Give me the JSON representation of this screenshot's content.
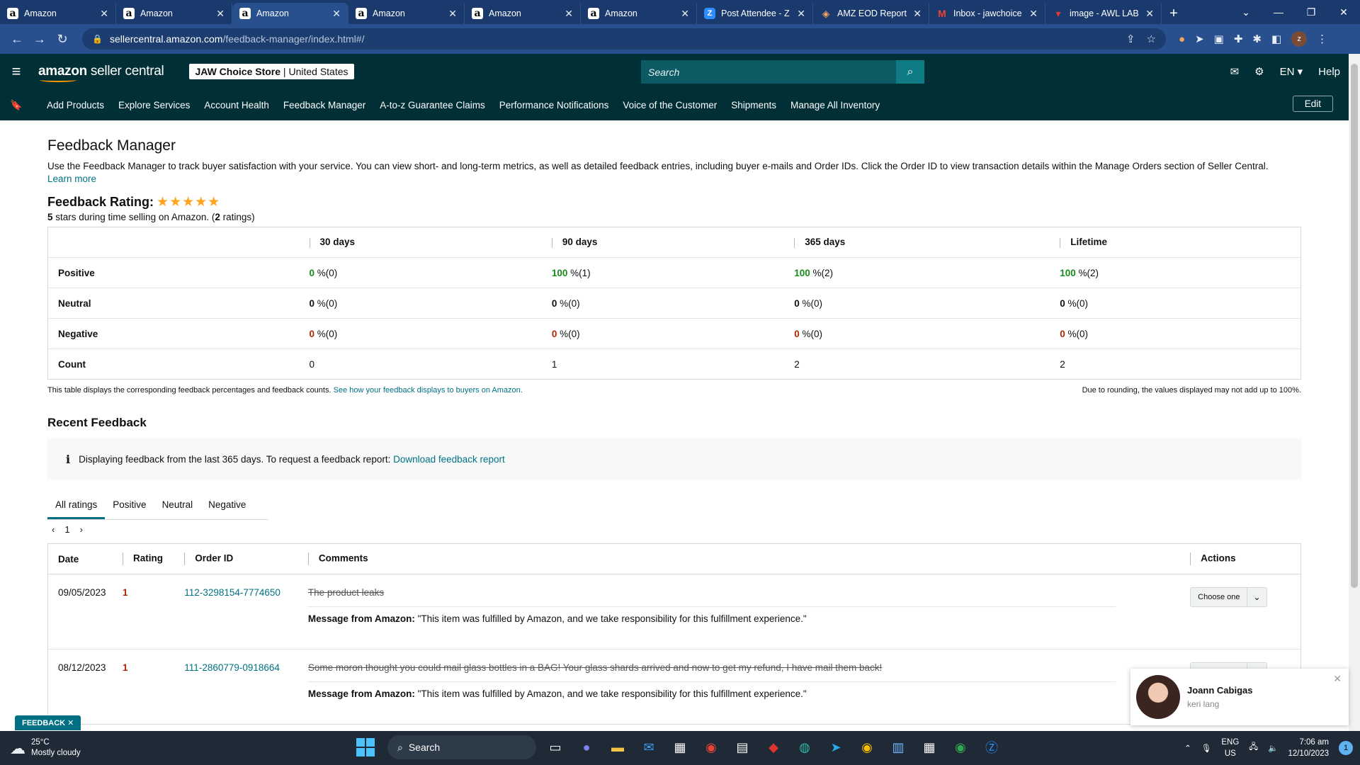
{
  "browser": {
    "tabs": [
      {
        "title": "Amazon",
        "icon": "amazon",
        "active": false
      },
      {
        "title": "Amazon",
        "icon": "amazon",
        "active": false
      },
      {
        "title": "Amazon",
        "icon": "amazon",
        "active": true
      },
      {
        "title": "Amazon",
        "icon": "amazon",
        "active": false
      },
      {
        "title": "Amazon",
        "icon": "amazon",
        "active": false
      },
      {
        "title": "Amazon",
        "icon": "amazon",
        "active": false
      },
      {
        "title": "Post Attendee - Z",
        "icon": "zoom",
        "active": false
      },
      {
        "title": "AMZ EOD Report",
        "icon": "eod",
        "active": false
      },
      {
        "title": "Inbox - jawchoice",
        "icon": "gmail",
        "active": false
      },
      {
        "title": "image - AWL LAB",
        "icon": "image",
        "active": false
      }
    ],
    "url_host": "sellercentral.amazon.com",
    "url_path": "/feedback-manager/index.html#/"
  },
  "header": {
    "logo_main": "amazon",
    "logo_sub": " seller central",
    "store_name": "JAW Choice Store",
    "store_region": "United States",
    "search_placeholder": "Search",
    "lang": "EN",
    "help": "Help"
  },
  "nav": {
    "items": [
      "Add Products",
      "Explore Services",
      "Account Health",
      "Feedback Manager",
      "A-to-z Guarantee Claims",
      "Performance Notifications",
      "Voice of the Customer",
      "Shipments",
      "Manage All Inventory"
    ],
    "edit": "Edit"
  },
  "page": {
    "title": "Feedback Manager",
    "intro": "Use the Feedback Manager to track buyer satisfaction with your service. You can view short- and long-term metrics, as well as detailed feedback entries, including buyer e-mails and Order IDs. Click the Order ID to view transaction details within the Manage Orders section of Seller Central.",
    "learn_more": "Learn more",
    "rating_label": "Feedback Rating:",
    "stars": "★★★★★",
    "rating_stars_count": "5",
    "rating_sub_mid": " stars during time selling on Amazon. (",
    "rating_count": "2",
    "rating_sub_end": " ratings)"
  },
  "metrics": {
    "columns": [
      "30 days",
      "90 days",
      "365 days",
      "Lifetime"
    ],
    "rows": [
      {
        "label": "Positive",
        "cells": [
          {
            "v": "0",
            "r": " %(0)"
          },
          {
            "v": "100",
            "r": " %(1)"
          },
          {
            "v": "100",
            "r": " %(2)"
          },
          {
            "v": "100",
            "r": " %(2)"
          }
        ]
      },
      {
        "label": "Neutral",
        "cells": [
          {
            "v": "0",
            "r": " %(0)"
          },
          {
            "v": "0",
            "r": " %(0)"
          },
          {
            "v": "0",
            "r": " %(0)"
          },
          {
            "v": "0",
            "r": " %(0)"
          }
        ]
      },
      {
        "label": "Negative",
        "cells": [
          {
            "v": "0",
            "r": " %(0)"
          },
          {
            "v": "0",
            "r": " %(0)"
          },
          {
            "v": "0",
            "r": " %(0)"
          },
          {
            "v": "0",
            "r": " %(0)"
          }
        ]
      },
      {
        "label": "Count",
        "cells": [
          {
            "v": "0",
            "r": ""
          },
          {
            "v": "1",
            "r": ""
          },
          {
            "v": "2",
            "r": ""
          },
          {
            "v": "2",
            "r": ""
          }
        ]
      }
    ],
    "footnote": "This table displays the corresponding feedback percentages and feedback counts.",
    "footnote_link": "See how your feedback displays to buyers on Amazon.",
    "rounding_note": "Due to rounding, the values displayed may not add up to 100%."
  },
  "recent": {
    "title": "Recent Feedback",
    "info_text": "Displaying feedback from the last 365 days. To request a feedback report:",
    "info_link": "Download feedback report",
    "filter_tabs": [
      "All ratings",
      "Positive",
      "Neutral",
      "Negative"
    ],
    "page": "1",
    "columns": [
      "Date",
      "Rating",
      "Order ID",
      "Comments",
      "Actions"
    ],
    "msg_label": "Message from Amazon:",
    "rows": [
      {
        "date": "09/05/2023",
        "rating": "1",
        "order_id": "112-3298154-7774650",
        "comment": "The product leaks",
        "message": "\"This item was fulfilled by Amazon, and we take responsibility for this fulfillment experience.\"",
        "action": "Choose one"
      },
      {
        "date": "08/12/2023",
        "rating": "1",
        "order_id": "111-2860779-0918664",
        "comment": "Some moron thought you could mail glass bottles in a BAG! Your glass shards arrived and now to get my refund, I have mail them back!",
        "message": "\"This item was fulfilled by Amazon, and we take responsibility for this fulfillment experience.\"",
        "action": "Choose one"
      }
    ]
  },
  "feedback_tab": "FEEDBACK",
  "chat": {
    "name": "Joann Cabigas",
    "message": "keri lang"
  },
  "taskbar": {
    "temp": "25°C",
    "weather": "Mostly cloudy",
    "search": "Search",
    "lang1": "ENG",
    "lang2": "US",
    "time": "7:06 am",
    "date": "12/10/2023",
    "notifications": "1"
  },
  "colors": {
    "header_bg": "#002f36",
    "positive": "#1a8a1a",
    "negative": "#b12704",
    "link": "#007185",
    "star": "#ffa41c"
  }
}
